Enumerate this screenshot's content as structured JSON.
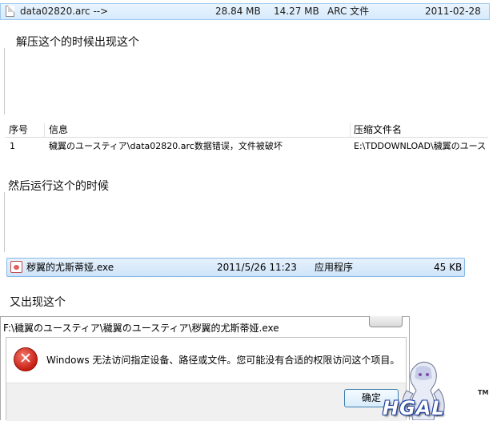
{
  "explorer_arc_row": {
    "name": "data02820.arc -->",
    "size": "28.84 MB",
    "packed_size": "14.27 MB",
    "type": "ARC 文件",
    "date": "2011-02-28"
  },
  "caption_1": "解压这个的时候出现这个",
  "error_list": {
    "headers": {
      "index": "序号",
      "message": "信息",
      "archive": "压缩文件名"
    },
    "rows": [
      {
        "index": "1",
        "message": "穢翼のユースティア\\data02820.arc数据错误，文件被破坏",
        "archive": "E:\\TDDOWNLOAD\\穢翼のユース"
      }
    ]
  },
  "caption_2": "然后运行这个的时候",
  "explorer_exe_row": {
    "name": "秽翼的尤斯蒂娅.exe",
    "date": "2011/5/26 11:23",
    "type": "应用程序",
    "size": "45 KB"
  },
  "caption_3": "又出现这个",
  "dialog": {
    "title": "F:\\穢翼のユースティア\\穢翼のユースティア\\秽翼的尤斯蒂娅.exe",
    "error_icon_glyph": "✕",
    "message": "Windows 无法访问指定设备、路径或文件。您可能没有合适的权限访问这个项目。",
    "ok_label": "确定"
  },
  "watermark": {
    "logo": "HGAL",
    "tm": "TM"
  },
  "colors": {
    "selection_border": "#84b7e7",
    "error_red": "#c81d12",
    "logo_blue": "#1c3fa0"
  }
}
